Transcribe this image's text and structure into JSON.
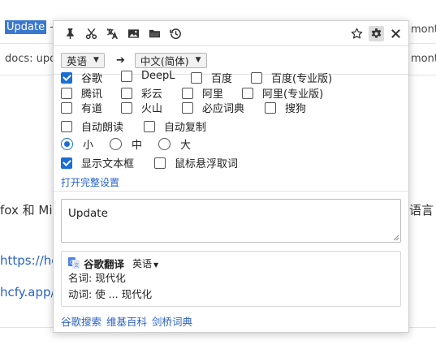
{
  "background": {
    "highlighted_word": "Update",
    "row1_suffix": " --",
    "row1_right": "mont",
    "row2_left": "docs: upd",
    "row2_right": "mont",
    "body_left": "fox 和 Mic",
    "body_right": "语言",
    "link1": "https://hc",
    "link2": "hcfy.app/"
  },
  "toolbar": {
    "icons": [
      "pin-icon",
      "scissors-icon",
      "no-translate-icon",
      "image-icon",
      "folder-icon",
      "history-icon"
    ],
    "right_icons": [
      "star-icon",
      "gear-icon",
      "close-icon"
    ]
  },
  "languages": {
    "source": "英语",
    "arrow": "➔",
    "target": "中文(简体)"
  },
  "engines": [
    {
      "label": "谷歌",
      "checked": true
    },
    {
      "label": "DeepL",
      "checked": false
    },
    {
      "label": "百度",
      "checked": false
    },
    {
      "label": "百度(专业版)",
      "checked": false
    },
    {
      "label": "腾讯",
      "checked": false
    },
    {
      "label": "彩云",
      "checked": false
    },
    {
      "label": "阿里",
      "checked": false
    },
    {
      "label": "阿里(专业版)",
      "checked": false
    },
    {
      "label": "有道",
      "checked": false
    },
    {
      "label": "火山",
      "checked": false
    },
    {
      "label": "必应词典",
      "checked": false
    },
    {
      "label": "搜狗",
      "checked": false
    }
  ],
  "options": {
    "auto_read": "自动朗读",
    "auto_copy": "自动复制",
    "size_small": "小",
    "size_medium": "中",
    "size_large": "大",
    "show_textbox": "显示文本框",
    "hover_word": "鼠标悬浮取词"
  },
  "settings_link": "打开完整设置",
  "input_text": "Update",
  "result": {
    "engine_name": "谷歌翻译",
    "source_lang": "英语",
    "definitions": [
      {
        "pos": "名词:",
        "text": "现代化"
      },
      {
        "pos": "动词:",
        "text": "使 ... 现代化"
      }
    ]
  },
  "footer_links": [
    "谷歌搜索",
    "维基百科",
    "剑桥词典"
  ],
  "colors": {
    "accent": "#1a6fd4",
    "link": "#2a62c8",
    "highlight": "#3a77d1"
  }
}
